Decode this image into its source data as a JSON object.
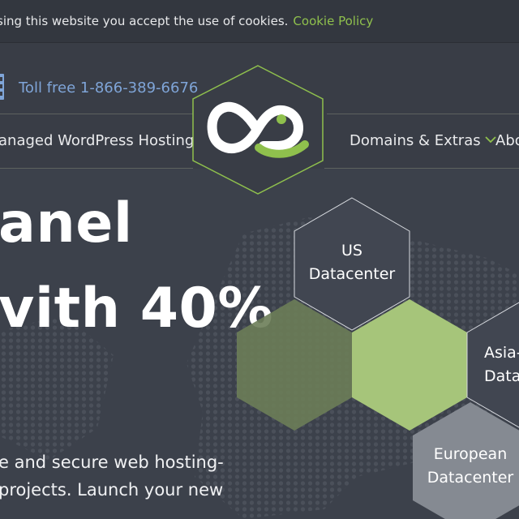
{
  "cookie_bar": {
    "text": "sing this website you accept the use of cookies.",
    "link_label": "Cookie Policy"
  },
  "header": {
    "phone_text": "Toll free 1-866-389-6676",
    "nav": {
      "left_item": "anaged WordPress Hosting",
      "domains": "Domains & Extras",
      "about_partial": "Abo"
    }
  },
  "hero": {
    "headline_line1": "anel",
    "headline_line2": "vith 40%",
    "desc_line1": "e and secure web hosting-",
    "desc_line2": "projects. Launch your new"
  },
  "datacenters": {
    "us_line1": "US",
    "us_line2": "Datacenter",
    "asia_line1": "Asia-",
    "asia_line2": "Data",
    "eu_line1": "European",
    "eu_line2": "Datacenter"
  },
  "colors": {
    "accent_green": "#8fc04d",
    "link_blue": "#7fa5d8",
    "background": "#3c414b"
  },
  "icons": [
    "phone-icon",
    "chevron-down-icon",
    "infinity-logo-icon"
  ]
}
